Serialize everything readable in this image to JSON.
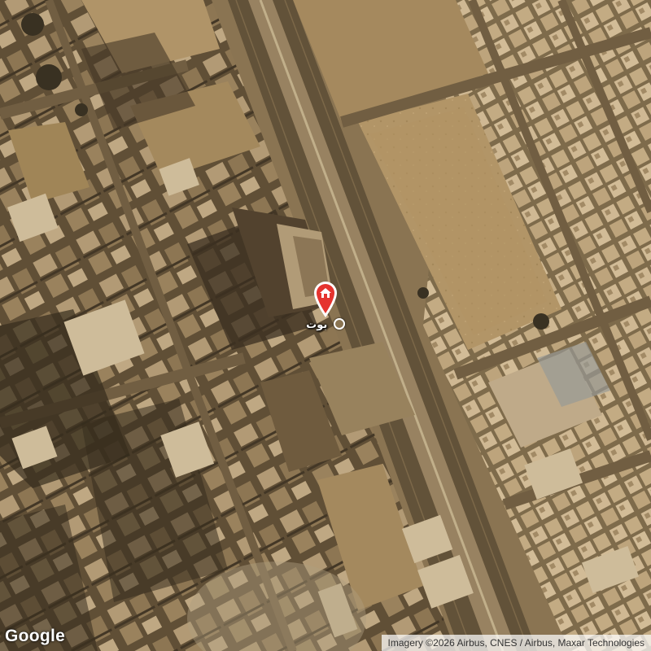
{
  "map": {
    "view": "satellite",
    "tint": "#8a7350",
    "place_label": "بوت",
    "pin_color": "#e5342f",
    "pin_icon": "home-icon"
  },
  "branding": {
    "logo_text": "Google"
  },
  "attribution": {
    "text": "Imagery ©2026 Airbus, CNES / Airbus, Maxar Technologies"
  }
}
